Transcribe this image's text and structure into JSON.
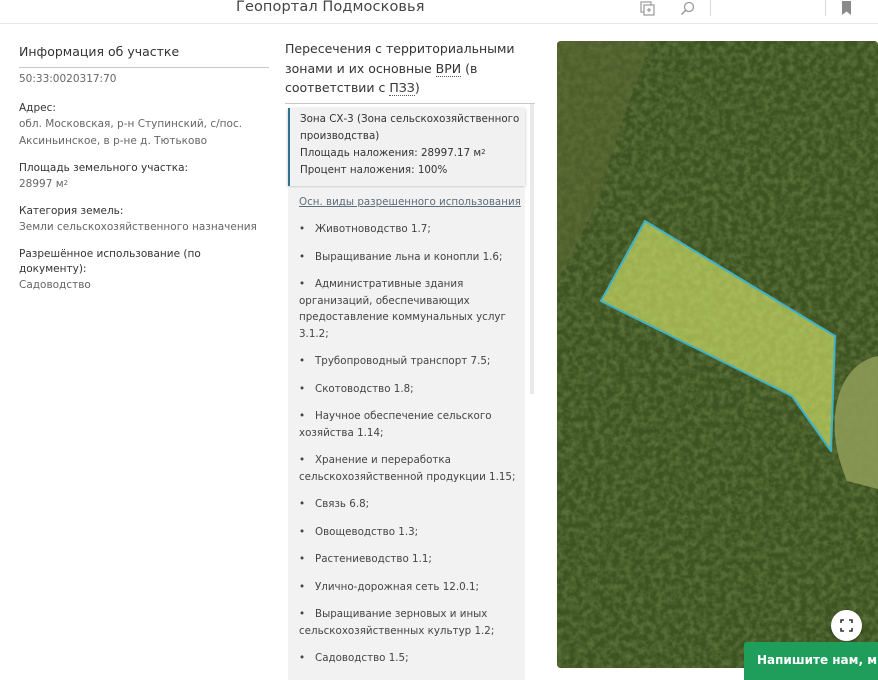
{
  "header": {
    "title": "Геопортал Подмосковья",
    "icons": [
      "select-area-icon",
      "search-icon",
      "bookmark-icon"
    ]
  },
  "parcel": {
    "panel_title": "Информация об участке",
    "cadastral_number": "50:33:0020317:70",
    "address_label": "Адрес:",
    "address_value": "обл. Московская, р-н Ступинский, с/пос. Аксиньинское, в р-не д. Тютьково",
    "area_label": "Площадь земельного участка:",
    "area_value": "28997 м",
    "area_unit_sup": "2",
    "category_label": "Категория земель:",
    "category_value": "Земли сельскохозяйственного назначения",
    "usage_label": "Разрешённое использование (по документу):",
    "usage_value": "Садоводство"
  },
  "zones": {
    "title_prefix": "Пересечения с территориальными зонами и их основные ",
    "title_vri": "ВРИ",
    "title_mid": " (в соответствии с ",
    "title_pzz": "ПЗЗ",
    "title_suffix": ")",
    "zone_name": "Зона СХ-3 (Зона сельскохозяйственного производства)",
    "overlap_area_label": "Площадь наложения: 28997.17 м",
    "overlap_area_sup": "2",
    "overlap_percent": "Процент наложения: 100%",
    "list_header": "Осн. виды разрешенного использования",
    "vri_items": [
      "Животноводство 1.7;",
      "Выращивание льна и конопли 1.6;",
      "Административные здания организаций, обеспечивающих предоставление коммунальных услуг 3.1.2;",
      "Трубопроводный транспорт 7.5;",
      "Скотоводство 1.8;",
      "Научное обеспечение сельского хозяйства 1.14;",
      "Хранение и переработка сельскохозяйственной продукции 1.15;",
      "Связь 6.8;",
      "Овощеводство 1.3;",
      "Растениеводство 1.1;",
      "Улично-дорожная сеть 12.0.1;",
      "Выращивание зерновых и иных сельскохозяйственных культур 1.2;",
      "Садоводство 1.5;"
    ]
  },
  "map": {
    "fullscreen_icon": "fullscreen-icon",
    "parcel_fill": "#d8e86a",
    "parcel_stroke": "#3fb3c8"
  },
  "chat": {
    "label": "Напишите нам, мы н"
  }
}
